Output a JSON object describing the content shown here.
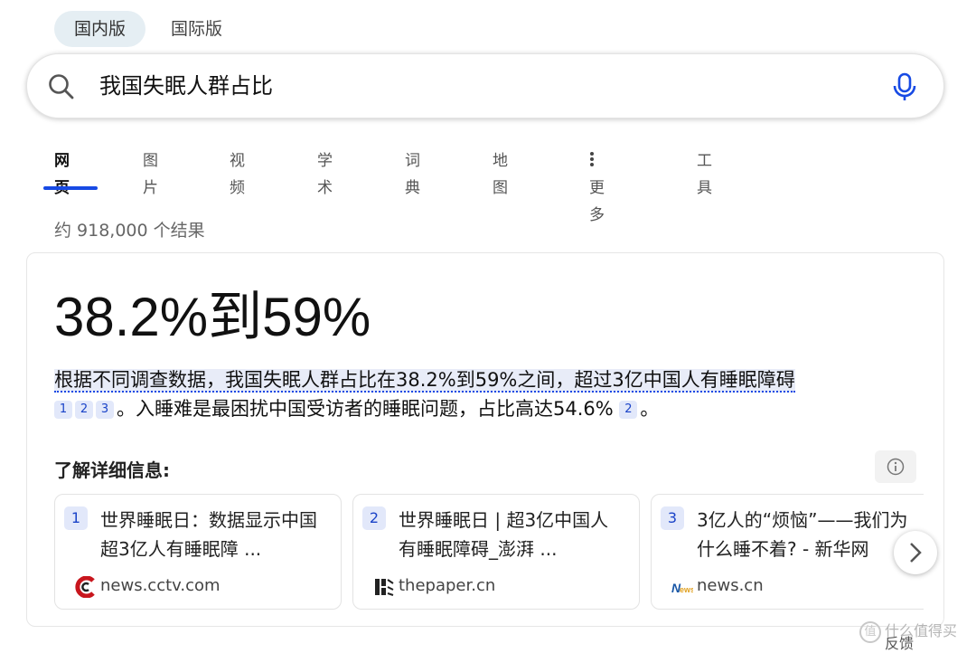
{
  "region_tabs": [
    "国内版",
    "国际版"
  ],
  "search": {
    "query": "我国失眠人群占比"
  },
  "nav": {
    "items": [
      "网页",
      "图片",
      "视频",
      "学术",
      "词典",
      "地图",
      "更多",
      "工具"
    ],
    "active": "网页"
  },
  "results_count": "约 918,000 个结果",
  "answer": {
    "headline": "38.2%到59%",
    "snippet_highlight": "根据不同调查数据，我国失眠人群占比在38.2%到59%之间，超过3亿中国人有睡眠障碍",
    "snippet_cites_a": [
      "1",
      "2",
      "3"
    ],
    "snippet_rest_a": "。入睡难是最困扰中国受访者的睡眠问题，占比高达54.6%",
    "snippet_cites_b": [
      "2"
    ],
    "snippet_rest_b": "。",
    "learn_more": "了解详细信息:"
  },
  "sources": [
    {
      "num": "1",
      "title": "世界睡眠日：数据显示中国超3亿人有睡眠障 ...",
      "site": "news.cctv.com",
      "favicon": "cctv-logo"
    },
    {
      "num": "2",
      "title": "世界睡眠日 | 超3亿中国人有睡眠障碍_澎湃 ...",
      "site": "thepaper.cn",
      "favicon": "thepaper-logo"
    },
    {
      "num": "3",
      "title": "3亿人的“烦恼”——我们为什么睡不着? - 新华网",
      "site": "news.cn",
      "favicon": "xinhua-news-logo"
    }
  ],
  "feedback": "反馈",
  "watermark": "什么值得买",
  "colors": {
    "accent": "#174ae4",
    "cite_bg": "#e2e8fa",
    "tab_active_bg": "#e5eef3"
  }
}
